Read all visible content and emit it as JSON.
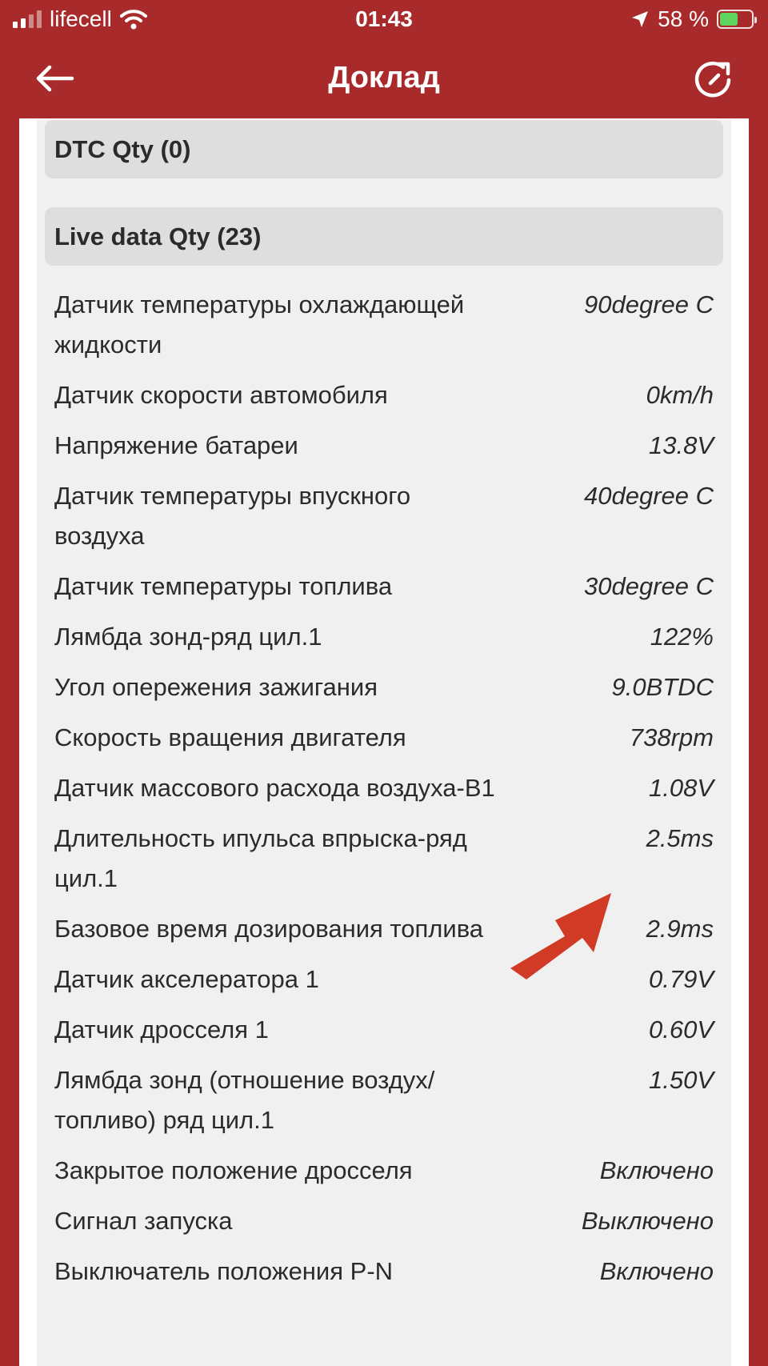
{
  "status_bar": {
    "carrier": "lifecell",
    "time": "01:43",
    "battery_percent": "58 %",
    "battery_level": 0.58,
    "battery_color": "#5ed35e"
  },
  "header": {
    "title": "Доклад",
    "back_icon": "arrow-left-icon",
    "refresh_icon": "refresh-icon",
    "background_color": "#a82a2a"
  },
  "sections": {
    "dtc": "DTC Qty (0)",
    "live": "Live data Qty (23)"
  },
  "live_data": [
    {
      "label": "Датчик температуры охлаждающей жидкости",
      "value": "90degree C"
    },
    {
      "label": "Датчик скорости автомобиля",
      "value": "0km/h"
    },
    {
      "label": "Напряжение батареи",
      "value": "13.8V"
    },
    {
      "label": "Датчик температуры впускного воздуха",
      "value": "40degree C"
    },
    {
      "label": "Датчик температуры топлива",
      "value": "30degree C"
    },
    {
      "label": "Лямбда зонд-ряд цил.1",
      "value": "122%"
    },
    {
      "label": "Угол опережения зажигания",
      "value": "9.0BTDC"
    },
    {
      "label": "Скорость вращения двигателя",
      "value": "738rpm"
    },
    {
      "label": "Датчик массового расхода воздуха-B1",
      "value": "1.08V"
    },
    {
      "label": "Длительность ипульса впрыска-ряд цил.1",
      "value": "2.5ms"
    },
    {
      "label": "Базовое время дозирования топлива",
      "value": "2.9ms"
    },
    {
      "label": "Датчик акселератора 1",
      "value": "0.79V"
    },
    {
      "label": "Датчик дросселя 1",
      "value": "0.60V"
    },
    {
      "label": "Лямбда зонд (отношение воздух/топливо) ряд цил.1",
      "value": "1.50V"
    },
    {
      "label": "Закрытое положение дросселя",
      "value": "Включено"
    },
    {
      "label": "Сигнал запуска",
      "value": "Выключено"
    },
    {
      "label": "Выключатель положения P-N",
      "value": "Включено"
    }
  ],
  "annotation": {
    "icon": "red-arrow-icon",
    "color": "#d13a24"
  }
}
